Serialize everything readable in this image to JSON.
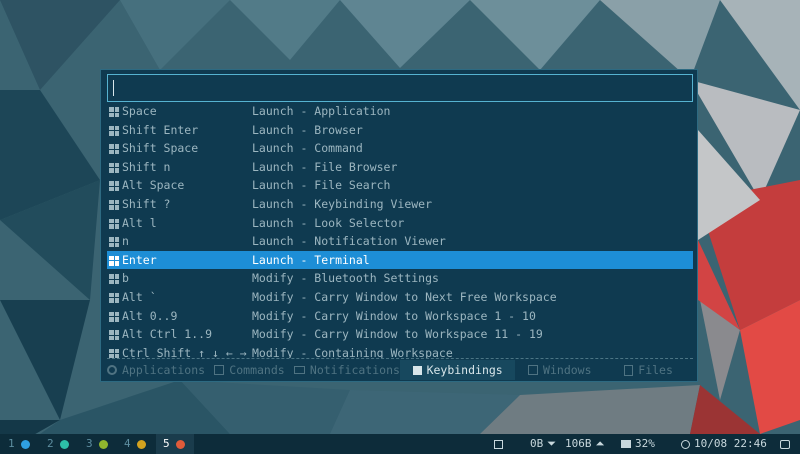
{
  "search": {
    "value": "",
    "placeholder": ""
  },
  "keybindings": [
    {
      "key": "Space",
      "action": "Launch - Application"
    },
    {
      "key": "Shift Enter",
      "action": "Launch - Browser"
    },
    {
      "key": "Shift Space",
      "action": "Launch - Command"
    },
    {
      "key": "Shift n",
      "action": "Launch - File Browser"
    },
    {
      "key": "Alt Space",
      "action": "Launch - File Search"
    },
    {
      "key": "Shift ?",
      "action": "Launch - Keybinding Viewer"
    },
    {
      "key": "Alt l",
      "action": "Launch - Look Selector"
    },
    {
      "key": "n",
      "action": "Launch - Notification Viewer"
    },
    {
      "key": "Enter",
      "action": "Launch - Terminal",
      "selected": true
    },
    {
      "key": "b",
      "action": "Modify - Bluetooth Settings"
    },
    {
      "key": "Alt `",
      "action": "Modify - Carry Window to Next Free Workspace"
    },
    {
      "key": "Alt 0..9",
      "action": "Modify - Carry Window to Workspace 1 - 10"
    },
    {
      "key": "Alt Ctrl 1..9",
      "action": "Modify - Carry Window to Workspace 11 - 19"
    },
    {
      "key": "Ctrl Shift ↑ ↓ ← →",
      "action": "Modify - Containing Workspace"
    }
  ],
  "tabs": [
    {
      "label": "Applications",
      "icon": "gear-icon"
    },
    {
      "label": "Commands",
      "icon": "terminal-icon"
    },
    {
      "label": "Notifications",
      "icon": "mail-icon"
    },
    {
      "label": "Keybindings",
      "icon": "key-icon",
      "active": true
    },
    {
      "label": "Windows",
      "icon": "window-icon"
    },
    {
      "label": "Files",
      "icon": "file-icon"
    }
  ],
  "taskbar": {
    "workspaces": [
      {
        "num": "1",
        "color": "#2f9fe0"
      },
      {
        "num": "2",
        "color": "#2dbfa8"
      },
      {
        "num": "3",
        "color": "#8fb52e"
      },
      {
        "num": "4",
        "color": "#d3a21f"
      },
      {
        "num": "5",
        "color": "#e05b3a",
        "current": true
      }
    ],
    "net_down": "0B",
    "net_up": "106B",
    "cpu": "32%",
    "clock": "10/08 22:46"
  },
  "colors": {
    "panel": "#0f3a50",
    "selection": "#1d8ed6",
    "accent_border": "#56b3d1",
    "taskbar": "#0d2c3a"
  }
}
